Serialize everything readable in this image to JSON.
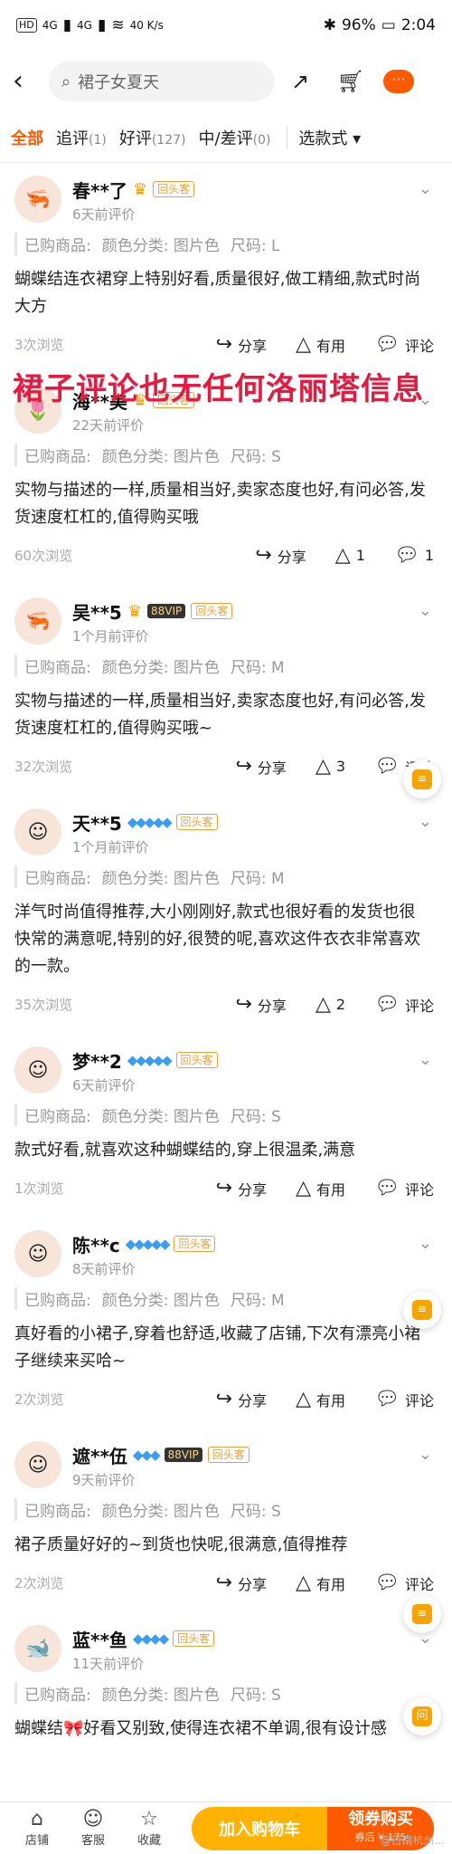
{
  "status_bar": {
    "left_chips": [
      "HD",
      "4G",
      "4G"
    ],
    "network_speed": "40 K/s",
    "battery": "96%",
    "time": "2:04"
  },
  "top_bar": {
    "back_icon": "chevron-left-icon",
    "search_placeholder": "裙子女夏天",
    "more_label": "···"
  },
  "filters": [
    {
      "label": "全部",
      "count": "",
      "active": true
    },
    {
      "label": "追评",
      "count": "(1)",
      "active": false
    },
    {
      "label": "好评",
      "count": "(127)",
      "active": false
    },
    {
      "label": "中/差评",
      "count": "(0)",
      "active": false
    }
  ],
  "style_select": "选款式 ▾",
  "overlay_text": "裙子评论也无任何洛丽塔信息",
  "reviews": [
    {
      "name": "春**了",
      "level": "crown",
      "vip": "",
      "badge": "回头客",
      "time": "6天前评价",
      "purchased": "已购商品:",
      "color": "颜色分类: 图片色",
      "size": "尺码: L",
      "text": "蝴蝶结连衣裙穿上特别好看,质量很好,做工精细,款式时尚大方",
      "views": "3次浏览",
      "share": "分享",
      "useful": "有用",
      "comment": "评论"
    },
    {
      "name": "海**美",
      "level": "crown",
      "vip": "",
      "badge": "回头客",
      "time": "22天前评价",
      "purchased": "已购商品:",
      "color": "颜色分类: 图片色",
      "size": "尺码: S",
      "text": "实物与描述的一样,质量相当好,卖家态度也好,有问必答,发货速度杠杠的,值得购买哦",
      "views": "60次浏览",
      "share": "分享",
      "useful": "1",
      "comment": "1"
    },
    {
      "name": "吴**5",
      "level": "crown",
      "vip": "88VIP",
      "badge": "回头客",
      "time": "1个月前评价",
      "purchased": "已购商品:",
      "color": "颜色分类: 图片色",
      "size": "尺码: M",
      "text": "实物与描述的一样,质量相当好,卖家态度也好,有问必答,发货速度杠杠的,值得购买哦~",
      "views": "32次浏览",
      "share": "分享",
      "useful": "3",
      "comment": "评论"
    },
    {
      "name": "天**5",
      "level": "diamond5",
      "vip": "",
      "badge": "回头客",
      "time": "1个月前评价",
      "purchased": "已购商品:",
      "color": "颜色分类: 图片色",
      "size": "尺码: M",
      "text": "洋气时尚值得推荐,大小刚刚好,款式也很好看的发货也很快常的满意呢,特别的好,很赞的呢,喜欢这件衣衣非常喜欢的一款。",
      "views": "35次浏览",
      "share": "分享",
      "useful": "2",
      "comment": "评论"
    },
    {
      "name": "梦**2",
      "level": "diamond5",
      "vip": "",
      "badge": "回头客",
      "time": "6天前评价",
      "purchased": "已购商品:",
      "color": "颜色分类: 图片色",
      "size": "尺码: S",
      "text": "款式好看,就喜欢这种蝴蝶结的,穿上很温柔,满意",
      "views": "1次浏览",
      "share": "分享",
      "useful": "有用",
      "comment": "评论"
    },
    {
      "name": "陈**c",
      "level": "diamond5",
      "vip": "",
      "badge": "回头客",
      "time": "8天前评价",
      "purchased": "已购商品:",
      "color": "颜色分类: 图片色",
      "size": "尺码: M",
      "text": "真好看的小裙子,穿着也舒适,收藏了店铺,下次有漂亮小裙子继续来买哈~",
      "views": "2次浏览",
      "share": "分享",
      "useful": "有用",
      "comment": "评论"
    },
    {
      "name": "遮**伍",
      "level": "diamond3",
      "vip": "88VIP",
      "badge": "回头客",
      "time": "9天前评价",
      "purchased": "已购商品:",
      "color": "颜色分类: 图片色",
      "size": "尺码: S",
      "text": "裙子质量好好的~到货也快呢,很满意,值得推荐",
      "views": "2次浏览",
      "share": "分享",
      "useful": "有用",
      "comment": "评论"
    },
    {
      "name": "蓝**鱼",
      "level": "diamond4",
      "vip": "",
      "badge": "回头客",
      "time": "11天前评价",
      "purchased": "已购商品:",
      "color": "颜色分类: 图片色",
      "size": "尺码: S",
      "text": "蝴蝶结🎀好看又别致,使得连衣裙不单调,很有设计感",
      "views": "",
      "share": "",
      "useful": "",
      "comment": ""
    }
  ],
  "bottom_bar": {
    "shop": "店铺",
    "service": "客服",
    "favorite": "收藏",
    "add_to_cart": "加入购物车",
    "buy_now": "领券购买",
    "buy_sub": "券后 ¥ 175",
    "watermark": "@日南杭州..."
  },
  "colors": {
    "accent": "#ff5a00",
    "overlay_red": "#e8193f",
    "badge": "#e8a13b",
    "diamond": "#3a9df2"
  }
}
